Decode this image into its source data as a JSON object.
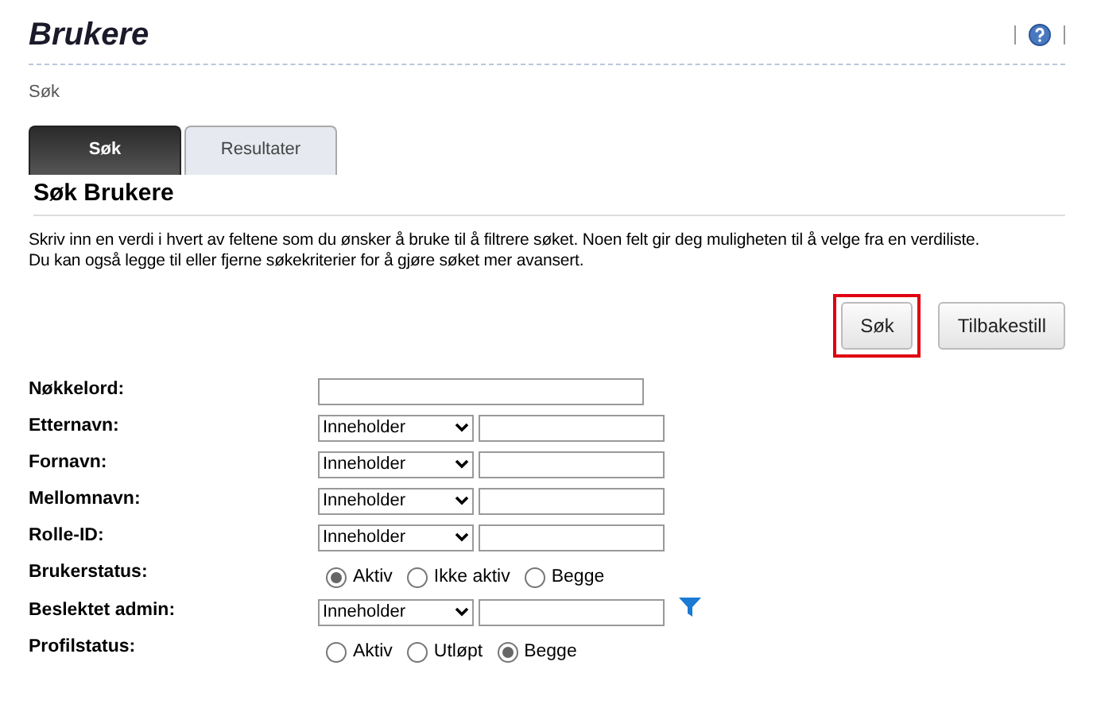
{
  "page_title": "Brukere",
  "breadcrumb": "Søk",
  "tabs": [
    {
      "label": "Søk",
      "selected": true
    },
    {
      "label": "Resultater",
      "selected": false
    }
  ],
  "section_title": "Søk Brukere",
  "instructions": [
    "Skriv inn en verdi i hvert av feltene som du ønsker å bruke til å filtrere søket. Noen felt gir deg muligheten til å velge fra en verdiliste.",
    "Du kan også legge til eller fjerne søkekriterier for å gjøre søket mer avansert."
  ],
  "buttons": [
    {
      "label": "Søk",
      "highlighted": true
    },
    {
      "label": "Tilbakestill"
    }
  ],
  "fields": [
    {
      "kind": "text",
      "label": "Nøkkelord:"
    },
    {
      "kind": "select",
      "label": "Etternavn:",
      "operator": "Inneholder"
    },
    {
      "kind": "select",
      "label": "Fornavn:",
      "operator": "Inneholder"
    },
    {
      "kind": "select",
      "label": "Mellomnavn:",
      "operator": "Inneholder"
    },
    {
      "kind": "select",
      "label": "Rolle-ID:",
      "operator": "Inneholder"
    },
    {
      "kind": "radio",
      "label": "Brukerstatus:",
      "options": [
        {
          "label": "Aktiv",
          "selected": true
        },
        {
          "label": "Ikke aktiv",
          "selected": false
        },
        {
          "label": "Begge",
          "selected": false
        }
      ]
    },
    {
      "kind": "select",
      "label": "Beslektet admin:",
      "operator": "Inneholder",
      "filter": true
    },
    {
      "kind": "radio",
      "label": "Profilstatus:",
      "options": [
        {
          "label": "Aktiv",
          "selected": false
        },
        {
          "label": "Utløpt",
          "selected": false
        },
        {
          "label": "Begge",
          "selected": true
        }
      ]
    }
  ]
}
